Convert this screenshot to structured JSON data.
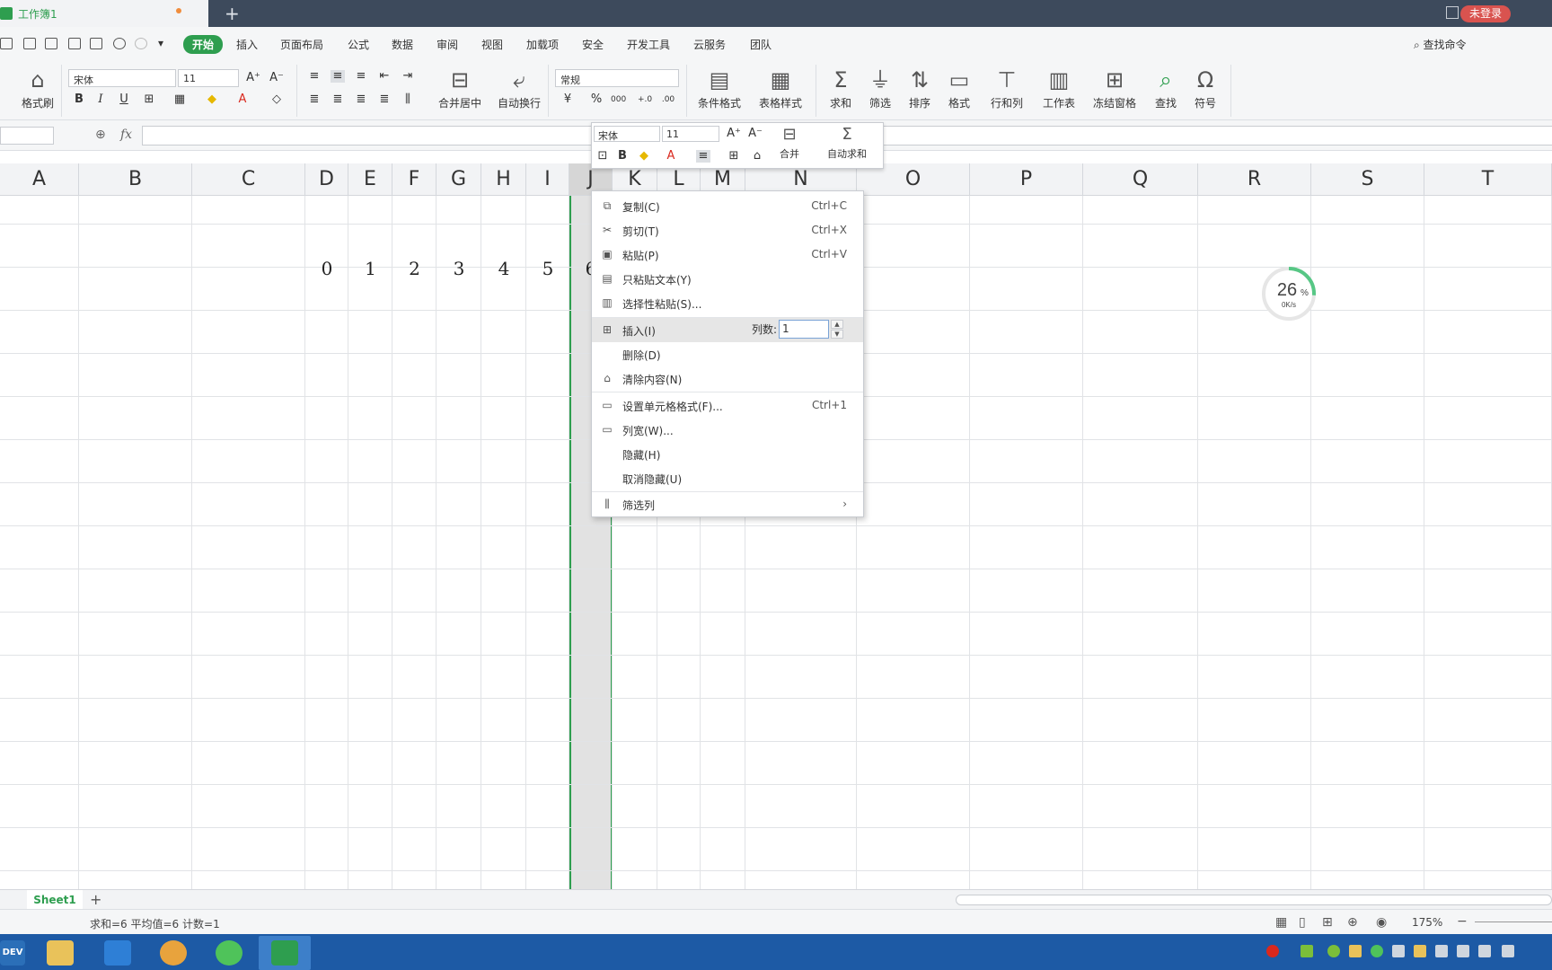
{
  "titlebar": {
    "doc_name": "工作簿1",
    "new_tab": "+",
    "login": "未登录"
  },
  "menubar": {
    "items": [
      "开始",
      "插入",
      "页面布局",
      "公式",
      "数据",
      "审阅",
      "视图",
      "加载项",
      "安全",
      "开发工具",
      "云服务",
      "团队"
    ],
    "search": "查找命令"
  },
  "ribbon": {
    "format_painter": "格式刷",
    "font_name": "宋体",
    "font_size": "11",
    "merge_center": "合并居中",
    "wrap_text": "自动换行",
    "number_format": "常规",
    "cond_format": "条件格式",
    "table_style": "表格样式",
    "sum": "求和",
    "filter": "筛选",
    "sort": "排序",
    "format": "格式",
    "row_col": "行和列",
    "worksheet": "工作表",
    "freeze": "冻结窗格",
    "find": "查找",
    "symbol": "符号",
    "bold": "B",
    "italic": "I",
    "underline": "U",
    "percent": "%",
    "grow_font": "A⁺",
    "shrink_font": "A⁻"
  },
  "formulabar": {
    "fx": "fx"
  },
  "mini_toolbar": {
    "font_name": "宋体",
    "font_size": "11",
    "merge": "合并",
    "autosum": "自动求和",
    "bold": "B"
  },
  "columns": [
    "A",
    "B",
    "C",
    "D",
    "E",
    "F",
    "G",
    "H",
    "I",
    "J",
    "K",
    "L",
    "M",
    "N",
    "O",
    "P",
    "Q",
    "R",
    "S",
    "T"
  ],
  "cells": [
    "0",
    "1",
    "2",
    "3",
    "4",
    "5",
    "6"
  ],
  "net_widget": {
    "percent": "26",
    "percent_sign": "%",
    "speed": "0K/s",
    "progress": 0.26
  },
  "context_menu": {
    "items": [
      {
        "label": "复制(C)",
        "shortcut": "Ctrl+C",
        "icon": "copy-icon"
      },
      {
        "label": "剪切(T)",
        "shortcut": "Ctrl+X",
        "icon": "cut-icon"
      },
      {
        "label": "粘贴(P)",
        "shortcut": "Ctrl+V",
        "icon": "paste-icon"
      },
      {
        "label": "只粘贴文本(Y)",
        "shortcut": "",
        "icon": "paste-text-icon"
      },
      {
        "label": "选择性粘贴(S)...",
        "shortcut": "",
        "icon": "paste-special-icon"
      },
      {
        "label": "插入(I)",
        "shortcut": "",
        "icon": "insert-icon"
      },
      {
        "label": "删除(D)",
        "shortcut": "",
        "icon": ""
      },
      {
        "label": "清除内容(N)",
        "shortcut": "",
        "icon": "eraser-icon"
      },
      {
        "label": "设置单元格格式(F)...",
        "shortcut": "Ctrl+1",
        "icon": "format-cells-icon"
      },
      {
        "label": "列宽(W)...",
        "shortcut": "",
        "icon": "column-width-icon"
      },
      {
        "label": "隐藏(H)",
        "shortcut": "",
        "icon": ""
      },
      {
        "label": "取消隐藏(U)",
        "shortcut": "",
        "icon": ""
      },
      {
        "label": "筛选列",
        "shortcut": "",
        "icon": "filter-columns-icon"
      }
    ],
    "insert_count_label": "列数:",
    "insert_count_value": "1"
  },
  "sheets": {
    "active": "Sheet1",
    "add": "+"
  },
  "statusbar": {
    "summary": "求和=6  平均值=6  计数=1",
    "zoom": "175%"
  },
  "taskbar": {
    "dev_label": "DEV"
  },
  "colors": {
    "accent": "#2e9e4f",
    "titlebar": "#3d4a5c",
    "taskbar": "#1d5aa5",
    "login": "#d9534f"
  }
}
